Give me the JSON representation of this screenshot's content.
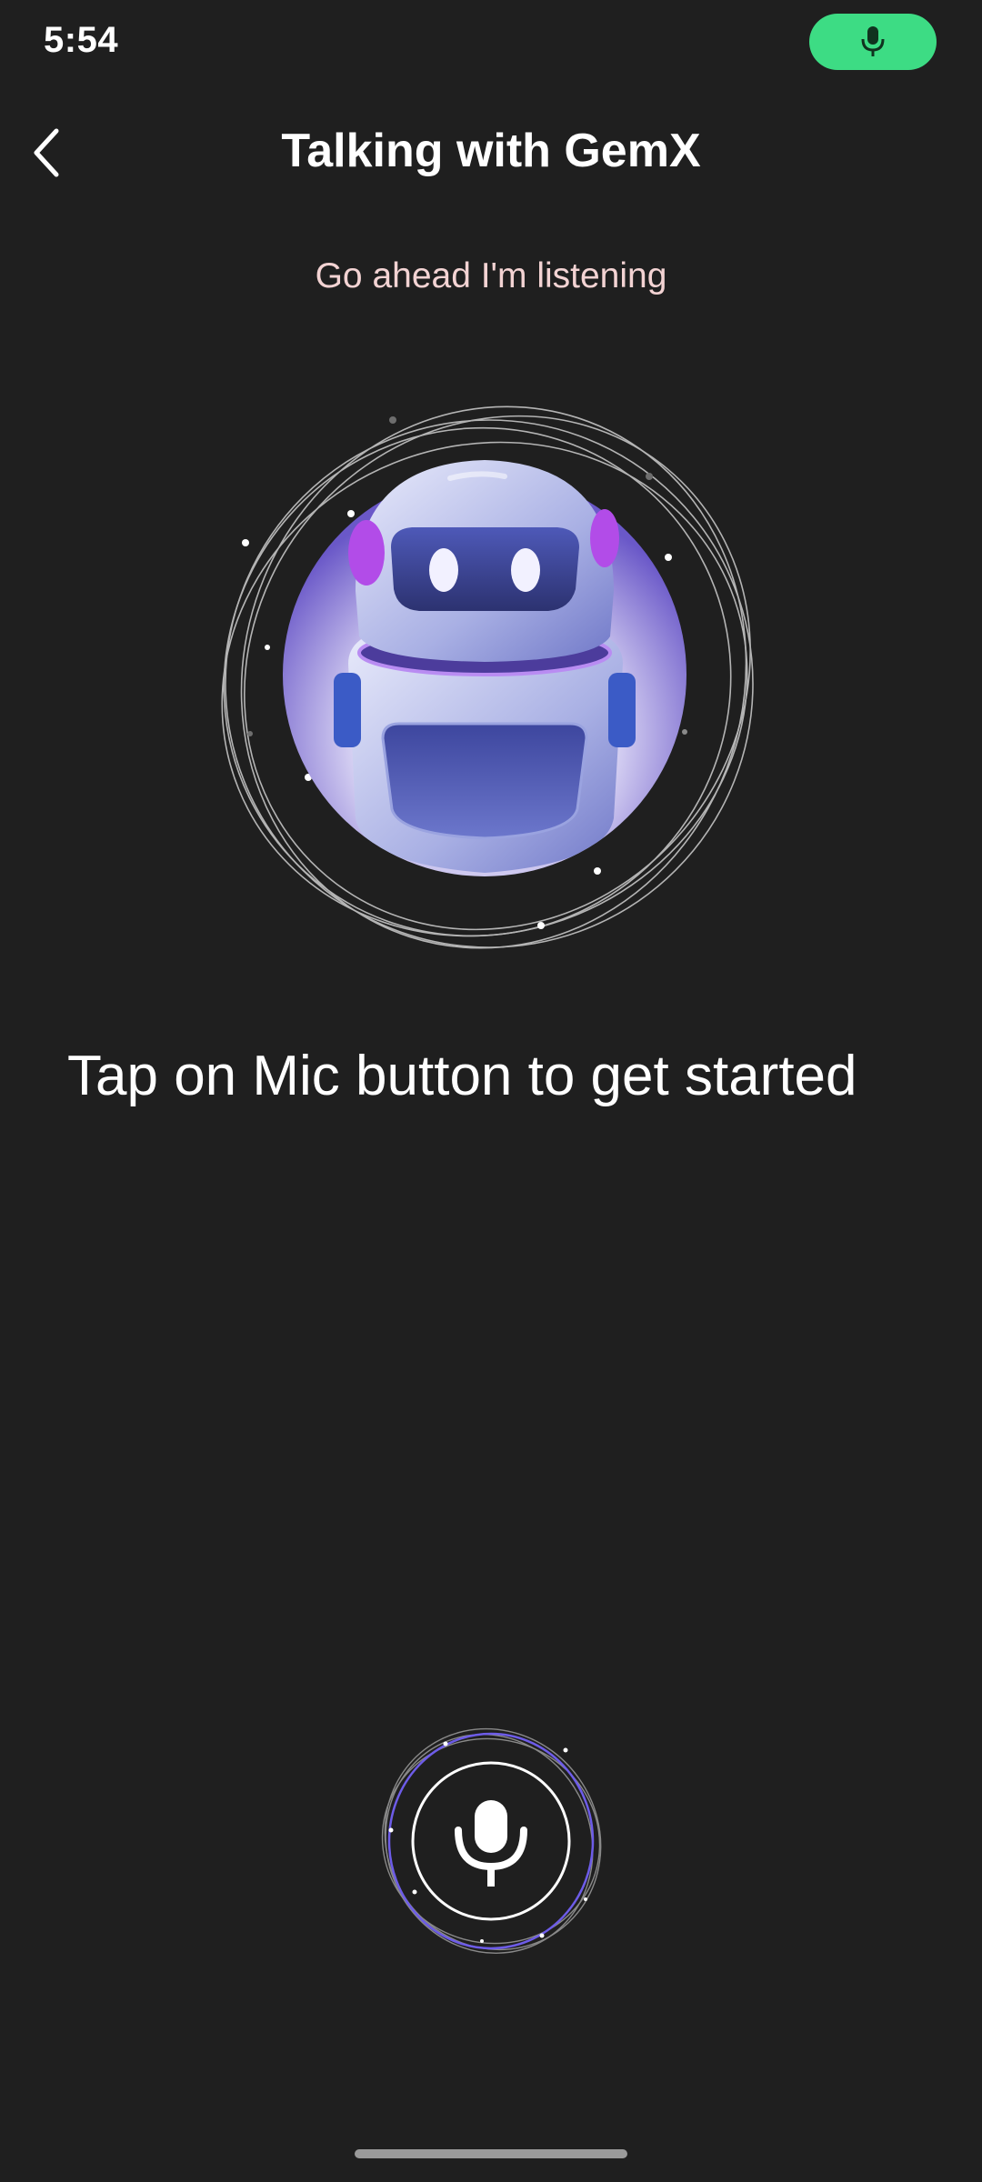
{
  "status_bar": {
    "time": "5:54",
    "mic_indicator_icon": "microphone-icon",
    "mic_indicator_color": "#3ddc84"
  },
  "header": {
    "back_icon": "chevron-left-icon",
    "title": "Talking with GemX"
  },
  "main": {
    "status_text": "Go ahead I'm listening",
    "assistant_image": "robot-avatar",
    "prompt": "Tap on Mic button to get started"
  },
  "controls": {
    "mic_button_icon": "microphone-icon"
  },
  "colors": {
    "background": "#1f1f1f",
    "accent_green": "#3ddc84",
    "subtitle_pink": "#f3d3d3",
    "ring_purple": "#6d5ce8"
  }
}
